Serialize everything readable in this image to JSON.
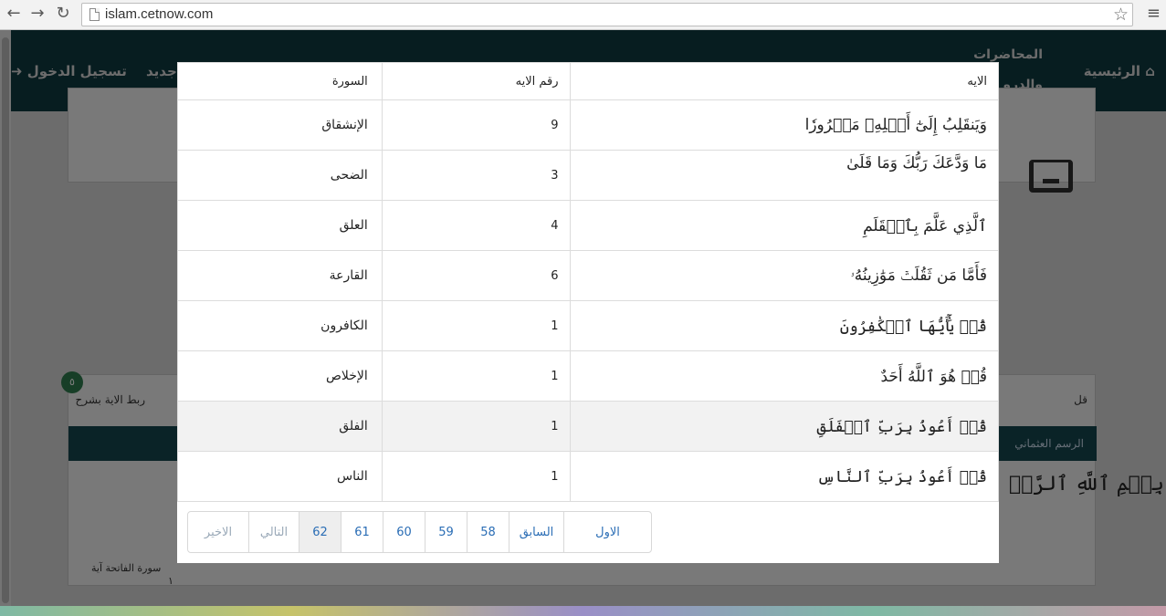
{
  "browser": {
    "url": "islam.cetnow.com",
    "back_icon": "←",
    "forward_icon": "→",
    "reload_icon": "↻",
    "star_icon": "☆",
    "menu_icon": "≡"
  },
  "background": {
    "nav": {
      "home": "⌂ الرئيسية",
      "lectures_line1": "المحاضرات",
      "lectures_line2": "والدرو",
      "new": "جديد",
      "login": "تسجيل الدخول ➜"
    },
    "badge": "٥",
    "link_explain": "ربط الاية بشرح",
    "qul": "قل",
    "script_label": "الرسم العثماني",
    "bismillah": "بِسۡمِ ٱللَّهِ ٱلرَّحۡ",
    "tooltip_line1": "سورة  الفاتحة  آية",
    "tooltip_line2": "١"
  },
  "modal": {
    "headers": {
      "aya": "الايه",
      "aya_number": "رقم الايه",
      "sura": "السورة"
    },
    "rows": [
      {
        "aya": "وَيَنقَلِبُ إِلَىٰٓ أَهۡلِهِۦ مَسۡرُورٗا",
        "number": "9",
        "sura": "الإنشقاق"
      },
      {
        "aya": "مَا وَدَّعَكَ رَبُّكَ وَمَا قَلَىٰ",
        "number": "3",
        "sura": "الضحى"
      },
      {
        "aya": "ٱلَّذِي عَلَّمَ بِٱلۡقَلَمِ",
        "number": "4",
        "sura": "العلق"
      },
      {
        "aya": "فَأَمَّا مَن ثَقُلَتۡ مَوَٰزِينُهُۥ",
        "number": "6",
        "sura": "القارعة"
      },
      {
        "aya": "قُلۡ يَٰٓأَيُّهَا ٱلۡكَٰفِرُونَ",
        "number": "1",
        "sura": "الكافرون"
      },
      {
        "aya": "قُلۡ هُوَ ٱللَّهُ أَحَدٌ",
        "number": "1",
        "sura": "الإخلاص"
      },
      {
        "aya": "قُلۡ أَعُوذُ بِرَبِّ ٱلۡفَلَقِ",
        "number": "1",
        "sura": "الفلق"
      },
      {
        "aya": "قُلۡ أَعُوذُ بِرَبِّ ٱلنَّاسِ",
        "number": "1",
        "sura": "الناس"
      }
    ],
    "pagination": {
      "first": "الاول",
      "prev": "السابق",
      "pages": [
        "58",
        "59",
        "60",
        "61",
        "62"
      ],
      "current": "62",
      "next": "التالي",
      "last": "الاخير"
    }
  }
}
